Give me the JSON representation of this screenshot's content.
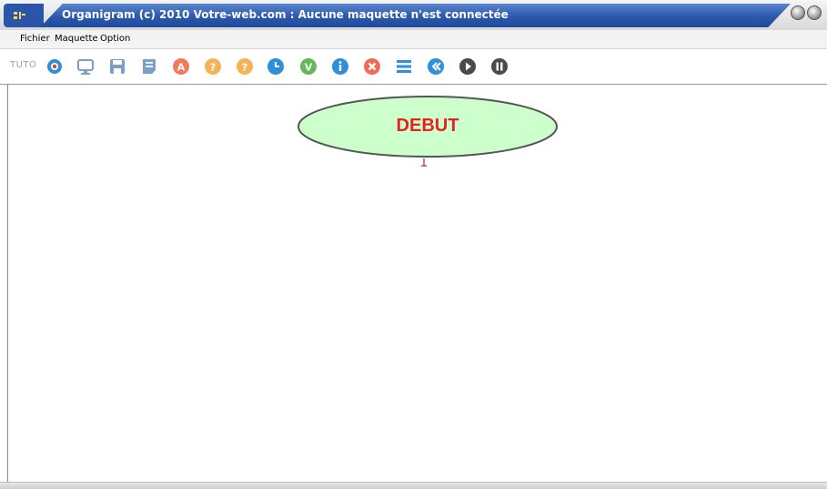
{
  "window": {
    "title": "Organigram (c) 2010 Votre-web.com :  Aucune maquette n'est connectée"
  },
  "menu": {
    "items": [
      {
        "label": "Fichier"
      },
      {
        "label": "Maquette"
      },
      {
        "label": "Option"
      }
    ]
  },
  "toolbar": {
    "tuto_label": "TUTO",
    "buttons": [
      {
        "icon": "settings-icon",
        "color": "#2f8fd8"
      },
      {
        "icon": "monitor-icon",
        "color": "#7aa0c8"
      },
      {
        "icon": "save-icon",
        "color": "#7aa0c8"
      },
      {
        "icon": "document-icon",
        "color": "#7aa0c8"
      },
      {
        "icon": "action-a-icon",
        "color": "#f07a5a",
        "glyph": "A"
      },
      {
        "icon": "help-question-icon",
        "color": "#f3b35a",
        "glyph": "?"
      },
      {
        "icon": "help-question-alt-icon",
        "color": "#f3b35a",
        "glyph": "?"
      },
      {
        "icon": "clock-icon",
        "color": "#2f8fd8"
      },
      {
        "icon": "validate-v-icon",
        "color": "#62b85a",
        "glyph": "V"
      },
      {
        "icon": "info-icon",
        "color": "#2f8fd8"
      },
      {
        "icon": "close-x-icon",
        "color": "#f06b55"
      },
      {
        "icon": "list-icon",
        "color": "#2f8fd8"
      },
      {
        "icon": "rewind-icon",
        "color": "#2f8fd8"
      },
      {
        "icon": "play-icon",
        "color": "#4a4a4a"
      },
      {
        "icon": "pause-icon",
        "color": "#4a4a4a"
      }
    ]
  },
  "canvas": {
    "start_node": {
      "label": "DEBUT",
      "fill": "#ccffcc",
      "text_color": "#e32222"
    }
  }
}
